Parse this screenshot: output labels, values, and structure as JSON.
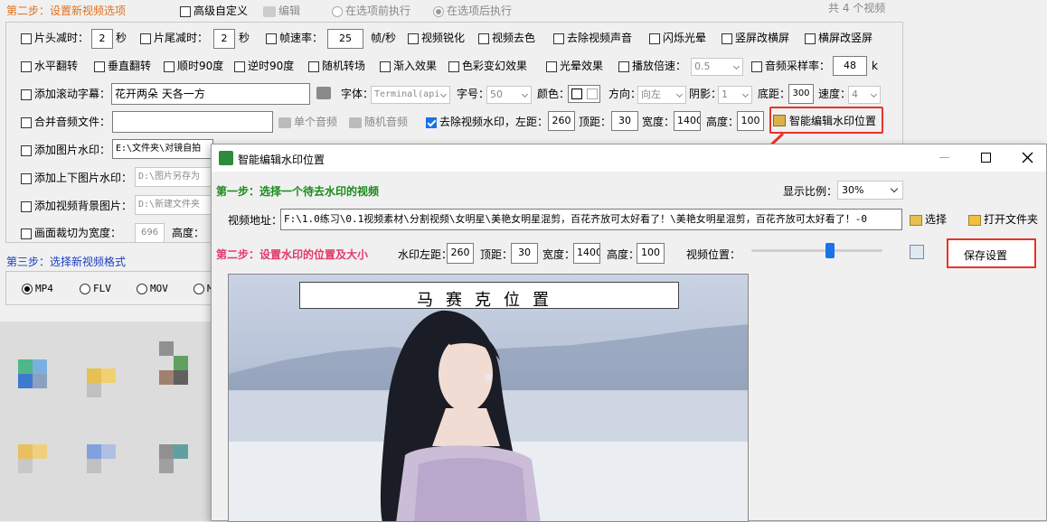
{
  "main": {
    "step2_title": "第二步：设置新视频选项",
    "advanced_custom": "高级自定义",
    "edit": "编辑",
    "before_exec": "在选项前执行",
    "after_exec": "在选项后执行",
    "video_count": "共 4 个视频",
    "row1": {
      "head_cut": "片头减时：",
      "head_val": "2",
      "sec1": "秒",
      "tail_cut": "片尾减时：",
      "tail_val": "2",
      "sec2": "秒",
      "fps": "帧速率：",
      "fps_val": "25",
      "fps_unit": "帧/秒",
      "sharpen": "视频锐化",
      "denoise": "视频去色",
      "remove_audio": "去除视频声音",
      "flash": "闪烁光晕",
      "v2h": "竖屏改横屏",
      "h2v": "横屏改竖屏"
    },
    "row2": {
      "hflip": "水平翻转",
      "vflip": "垂直翻转",
      "cw90": "顺时90度",
      "ccw90": "逆时90度",
      "random_trans": "随机转场",
      "fade_in": "渐入效果",
      "color_change": "色彩变幻效果",
      "halo": "光晕效果",
      "speed": "播放倍速：",
      "speed_val": "0.5",
      "sample_rate": "音频采样率：",
      "sample_val": "48",
      "k": "k"
    },
    "row3": {
      "scroll_sub": "添加滚动字幕：",
      "sub_text": "花开两朵 天各一方",
      "font": "字体：",
      "font_val": "Terminal(api",
      "size": "字号：",
      "size_val": "50",
      "color": "颜色：",
      "direction": "方向：",
      "dir_val": "向左",
      "shadow": "阴影：",
      "shadow_val": "1",
      "bottom": "底距：",
      "bottom_val": "300",
      "speed": "速度：",
      "speed_val": "4"
    },
    "row4": {
      "merge_audio": "合并音频文件：",
      "single_audio": "单个音频",
      "random_audio": "随机音频",
      "remove_wm": "去除视频水印，左距：",
      "left_val": "260",
      "top": "顶距：",
      "top_val": "30",
      "width": "宽度：",
      "width_val": "1400",
      "height": "高度：",
      "height_val": "100",
      "smart_edit": "智能编辑水印位置"
    },
    "row5": {
      "img_wm": "添加图片水印：",
      "img_path": "E:\\文件夹\\对镜自拍"
    },
    "row6": {
      "updown_wm": "添加上下图片水印：",
      "updown_path": "D:\\图片另存为"
    },
    "row7": {
      "bg_img": "添加视频背景图片：",
      "bg_path": "D:\\新建文件夹"
    },
    "row8": {
      "crop": "画面裁切为宽度：",
      "crop_w": "696",
      "crop_h_label": "高度："
    },
    "step3_title": "第三步：选择新视频格式",
    "formats": [
      "MP4",
      "FLV",
      "MOV",
      "M"
    ]
  },
  "dialog": {
    "title": "智能编辑水印位置",
    "step1": "第一步：选择一个待去水印的视频",
    "ratio_label": "显示比例：",
    "ratio_val": "30%",
    "addr_label": "视频地址：",
    "addr_val": "F:\\1.0练习\\0.1视频素材\\分割视频\\女明星\\美艳女明星混剪，百花齐放可太好看了！\\美艳女明星混剪，百花齐放可太好看了！-0",
    "choose": "选择",
    "open_folder": "打开文件夹",
    "step2": "第二步：设置水印的位置及大小",
    "wm_left": "水印左距：",
    "wm_left_val": "260",
    "wm_top": "顶距：",
    "wm_top_val": "30",
    "wm_width": "宽度：",
    "wm_width_val": "1400",
    "wm_height": "高度：",
    "wm_height_val": "100",
    "video_pos": "视频位置：",
    "slider_level": 0.6,
    "save": "保存设置",
    "mosaic_text": "马赛克位置"
  },
  "colors": {
    "orange_title": "#e0701a",
    "blue_title": "#1a3cc0",
    "green_title": "#1a8a1a",
    "pink_title": "#e23a6a",
    "highlight_red": "#e8332a",
    "accent_blue": "#1a73e8"
  }
}
